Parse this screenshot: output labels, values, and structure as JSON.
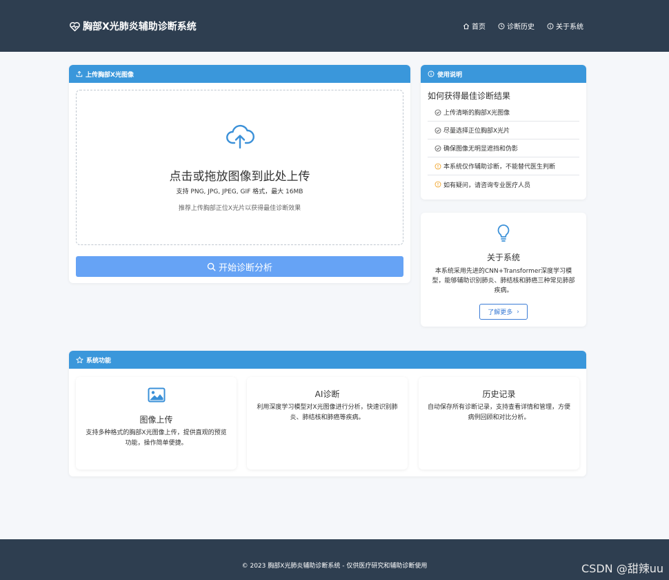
{
  "header": {
    "brand": "胸部X光肺炎辅助诊断系统",
    "nav": [
      {
        "label": "首页",
        "icon": "home-icon"
      },
      {
        "label": "诊断历史",
        "icon": "clock-icon"
      },
      {
        "label": "关于系统",
        "icon": "info-icon"
      }
    ]
  },
  "upload": {
    "header": "上传胸部X光图像",
    "title": "点击或拖放图像到此处上传",
    "formats": "支持 PNG, JPG, JPEG, GIF 格式，最大 16MB",
    "hint": "推荐上传胸部正位X光片以获得最佳诊断效果",
    "button": "开始诊断分析"
  },
  "usage": {
    "header": "使用说明",
    "title": "如何获得最佳诊断结果",
    "items": [
      {
        "text": "上传清晰的胸部X光图像",
        "icon": "check-circle-icon"
      },
      {
        "text": "尽量选择正位胸部X光片",
        "icon": "check-circle-icon"
      },
      {
        "text": "确保图像无明显遮挡和伪影",
        "icon": "check-circle-icon"
      },
      {
        "text": "本系统仅作辅助诊断，不能替代医生判断",
        "icon": "warning-circle-icon"
      },
      {
        "text": "如有疑问，请咨询专业医疗人员",
        "icon": "warning-circle-icon"
      }
    ]
  },
  "about": {
    "title": "关于系统",
    "desc": "本系统采用先进的CNN+Transformer深度学习模型，能够辅助识别肺炎、肺结核和肺癌三种常见肺部疾病。",
    "button": "了解更多"
  },
  "features": {
    "header": "系统功能",
    "items": [
      {
        "title": "图像上传",
        "desc": "支持多种格式的胸部X光图像上传，提供直观的预览功能，操作简单便捷。",
        "icon": "image-icon"
      },
      {
        "title": "AI诊断",
        "desc": "利用深度学习模型对X光图像进行分析，快速识别肺炎、肺结核和肺癌等疾病。"
      },
      {
        "title": "历史记录",
        "desc": "自动保存所有诊断记录，支持查看详情和管理，方便病例回顾和对比分析。"
      }
    ]
  },
  "footer": {
    "text": "© 2023 胸部X光肺炎辅助诊断系统 - 仅供医疗研究和辅助诊断使用"
  },
  "watermark": "CSDN @甜辣uu",
  "colors": {
    "navbar": "#2e3e50",
    "accent": "#3a97db",
    "button": "#66a3f5",
    "success": "#27a744",
    "warning": "#f0a020"
  }
}
